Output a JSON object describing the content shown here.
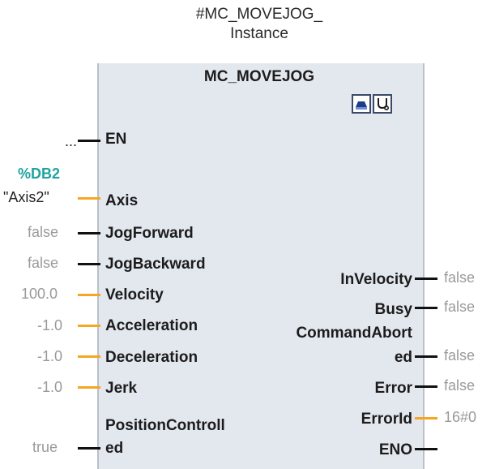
{
  "instance": {
    "line1": "#MC_MOVEJOG_",
    "line2": "Instance"
  },
  "block": {
    "title": "MC_MOVEJOG",
    "icons": [
      "axis-tool-icon",
      "diagnostics-icon"
    ]
  },
  "colors": {
    "bool_line": "#111111",
    "data_line": "#f5a623",
    "db_accent": "#20a39e",
    "value_gray": "#9a9a9a"
  },
  "inputs": {
    "en": {
      "pin": "EN",
      "value": "..."
    },
    "axis": {
      "pin": "Axis",
      "db_ref": "%DB2",
      "value": "\"Axis2\""
    },
    "jog_forward": {
      "pin": "JogForward",
      "value": "false"
    },
    "jog_backward": {
      "pin": "JogBackward",
      "value": "false"
    },
    "velocity": {
      "pin": "Velocity",
      "value": "100.0"
    },
    "acceleration": {
      "pin": "Acceleration",
      "value": "-1.0"
    },
    "deceleration": {
      "pin": "Deceleration",
      "value": "-1.0"
    },
    "jerk": {
      "pin": "Jerk",
      "value": "-1.0"
    },
    "position_controlled": {
      "pin_line1": "PositionControll",
      "pin_line2": "ed",
      "value": "true"
    }
  },
  "outputs": {
    "in_velocity": {
      "pin": "InVelocity",
      "value": "false"
    },
    "busy": {
      "pin": "Busy",
      "value": "false"
    },
    "command_aborted": {
      "pin_line1": "CommandAbort",
      "pin_line2": "ed",
      "value": "false"
    },
    "error": {
      "pin": "Error",
      "value": "false"
    },
    "error_id": {
      "pin": "ErrorId",
      "value": "16#0"
    },
    "eno": {
      "pin": "ENO"
    }
  }
}
